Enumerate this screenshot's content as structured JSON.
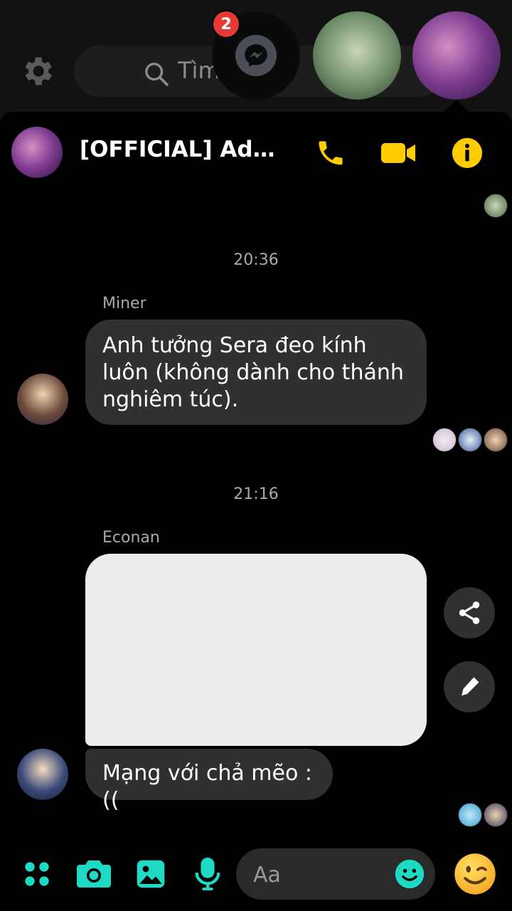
{
  "background": {
    "search_placeholder": "Tìm kiếm"
  },
  "chat_heads": {
    "badge_count": "2"
  },
  "header": {
    "title": "[OFFICIAL] Admin..."
  },
  "timestamps": [
    "20:36",
    "21:16"
  ],
  "messages": [
    {
      "sender": "Miner",
      "text": "Anh tưởng Sera đeo kính luôn (không dành cho thánh nghiêm túc)."
    },
    {
      "sender": "Econan",
      "text": "Mạng với chả mẽo :(("
    }
  ],
  "composer": {
    "placeholder": "Aa"
  },
  "colors": {
    "accent_yellow": "#FFCC00",
    "accent_teal": "#1ED9C4",
    "bubble": "#303030"
  },
  "icons": [
    "gear-icon",
    "search-icon",
    "messenger-icon",
    "phone-icon",
    "video-icon",
    "info-icon",
    "share-icon",
    "edit-icon",
    "menu-grid-icon",
    "camera-icon",
    "image-icon",
    "mic-icon",
    "emoji-icon",
    "wink-emoji-icon"
  ]
}
